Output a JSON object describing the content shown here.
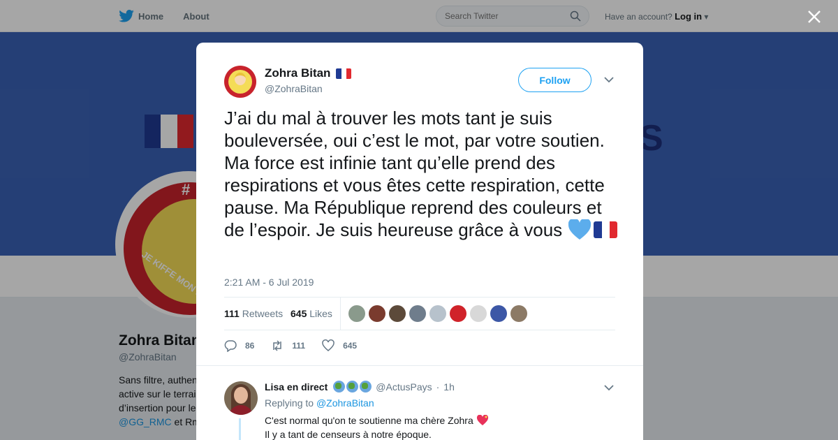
{
  "nav": {
    "home_label": "Home",
    "about_label": "About",
    "search_placeholder": "Search Twitter",
    "account_prompt": "Have an account?",
    "login_label": "Log in"
  },
  "profile_bg": {
    "name": "Zohra Bitan",
    "handle": "@ZohraBitan",
    "bio_lines": [
      "Sans filtre, authen",
      "active sur le terrai",
      "d’insertion pour le"
    ],
    "bio_link": "@GG_RMC",
    "bio_after_link": " et Rm",
    "avatar_hash": "#",
    "avatar_arc_text": "JE KIFFE MON D"
  },
  "tweet": {
    "author_name": "Zohra Bitan",
    "author_handle": "@ZohraBitan",
    "follow_label": "Follow",
    "text": "J’ai du mal à trouver les mots tant je suis bouleversée, oui c’est le mot, par votre soutien. Ma force est infinie tant qu’elle prend des respirations et vous êtes cette respiration, cette pause. Ma République reprend des couleurs et de l’espoir. Je suis heureuse grâce à vous",
    "timestamp": "2:21 AM - 6 Jul 2019",
    "retweets_count": "111",
    "retweets_label": "Retweets",
    "likes_count": "645",
    "likes_label": "Likes",
    "replies_action": "86",
    "retweets_action": "111",
    "likes_action": "645",
    "liker_colors": [
      "#8a9a8c",
      "#7a3b2e",
      "#5c4a3a",
      "#6f7d8c",
      "#b7c2cc",
      "#d0232a",
      "#d8d8d8",
      "#3c57a6",
      "#8c7a66"
    ]
  },
  "reply": {
    "author_name": "Lisa en direct",
    "author_handle": "@ActusPays",
    "time": "1h",
    "replying_prefix": "Replying to",
    "replying_to": "@ZohraBitan",
    "line1": "C'est normal qu'on te soutienne ma chère Zohra",
    "line2": "Il y a tant de censeurs à notre époque."
  },
  "colors": {
    "accent": "#1da1f2",
    "banner": "#3a62b6",
    "flag_blue": "#1f3a93",
    "flag_red": "#e1292f"
  }
}
